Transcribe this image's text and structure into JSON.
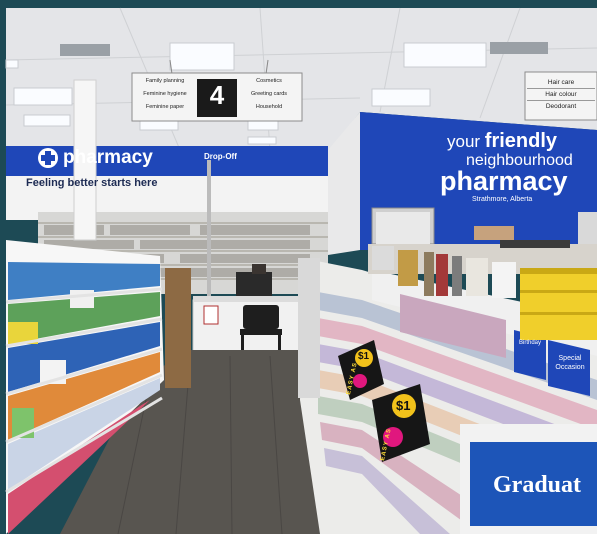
{
  "store_sign": {
    "brand": "pharmacy",
    "tagline": "Feeling better starts here",
    "dropoff": "Drop-Off"
  },
  "aisle_sign": {
    "number": "4",
    "left_items": [
      "Family planning",
      "Feminine hygiene",
      "Feminine paper"
    ],
    "right_items": [
      "Cosmetics",
      "Greeting cards",
      "Household"
    ]
  },
  "right_sign": {
    "items": [
      "Hair care",
      "Hair colour",
      "Deodorant"
    ]
  },
  "wall_sign": {
    "line1a": "your ",
    "line1b": "friendly",
    "line2": "neighbourhood",
    "line3": "pharmacy",
    "location": "Strathmore, Alberta"
  },
  "card_rack": {
    "price": "$1",
    "price_caption": "EASY AS",
    "tabs": [
      "Birthday",
      "Special Occasion"
    ],
    "graduation_sign": "Graduat"
  },
  "colors": {
    "frame": "#1d4a55",
    "brand_blue": "#1f47b8",
    "ceiling": "#e6e6e8",
    "floor": "#5a5753"
  },
  "icons": {
    "brand_logo": "plus-cross-icon"
  }
}
